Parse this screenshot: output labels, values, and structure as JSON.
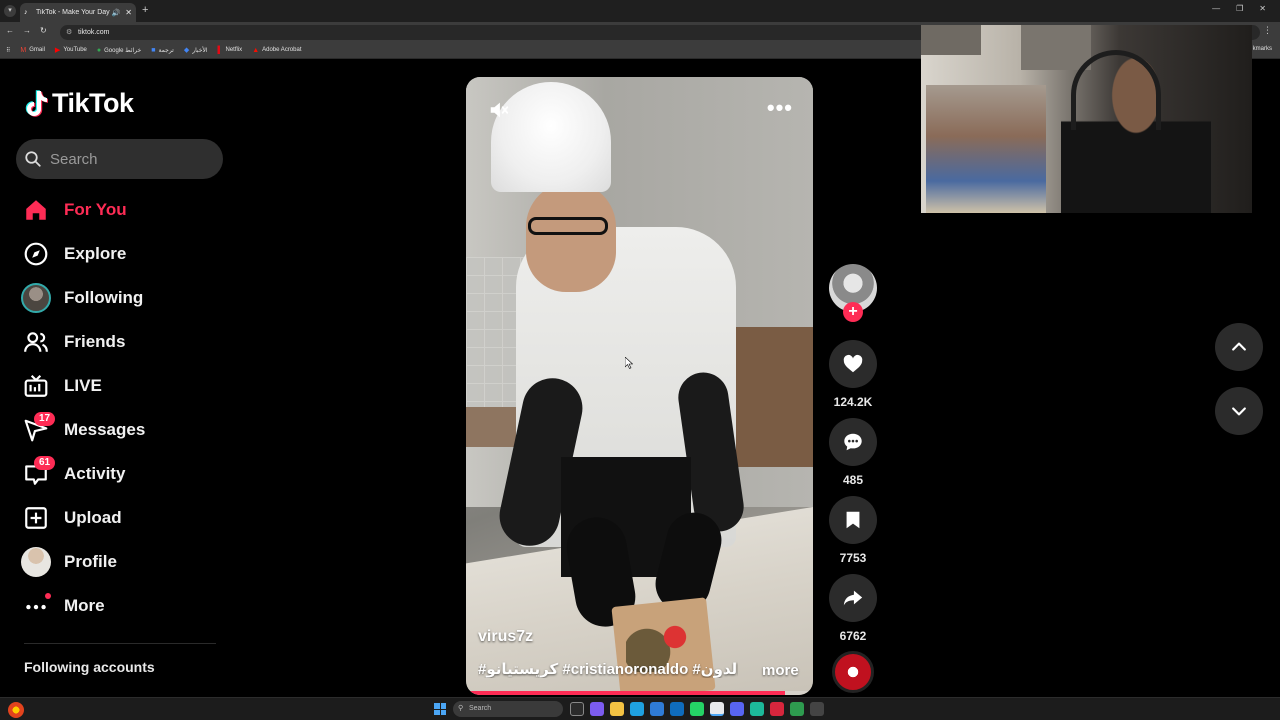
{
  "browser": {
    "tab_title": "TikTok - Make Your Day",
    "url": "tiktok.com",
    "bookmarks": [
      {
        "label": "Gmail",
        "icon": "gmail-icon",
        "color": "#ea4335"
      },
      {
        "label": "YouTube",
        "icon": "youtube-icon",
        "color": "#ff0000"
      },
      {
        "label": "Google خرائط",
        "icon": "maps-icon",
        "color": "#34a853"
      },
      {
        "label": "ترجمة",
        "icon": "translate-icon",
        "color": "#4285f4"
      },
      {
        "label": "الأخبار",
        "icon": "news-icon",
        "color": "#4285f4"
      },
      {
        "label": "Netflix",
        "icon": "netflix-icon",
        "color": "#e50914"
      },
      {
        "label": "Adobe Acrobat",
        "icon": "acrobat-icon",
        "color": "#f40f02"
      }
    ],
    "bookmarks_right": "kmarks"
  },
  "app": {
    "brand": "TikTok",
    "accent": "#fe2c55",
    "search_placeholder": "Search"
  },
  "sidebar": {
    "items": [
      {
        "label": "For You",
        "icon": "home-icon",
        "active": true
      },
      {
        "label": "Explore",
        "icon": "compass-icon"
      },
      {
        "label": "Following",
        "icon": "following-avatar"
      },
      {
        "label": "Friends",
        "icon": "friends-icon"
      },
      {
        "label": "LIVE",
        "icon": "live-tv-icon"
      },
      {
        "label": "Messages",
        "icon": "send-icon",
        "badge": "17"
      },
      {
        "label": "Activity",
        "icon": "inbox-icon",
        "badge": "61"
      },
      {
        "label": "Upload",
        "icon": "plus-square-icon"
      },
      {
        "label": "Profile",
        "icon": "profile-avatar"
      },
      {
        "label": "More",
        "icon": "more-dots-icon"
      }
    ],
    "following_accounts": "Following accounts"
  },
  "video": {
    "author": "virus7z",
    "hashtags": "#كريستيانو #cristianoronaldo #الدون ...",
    "more_label": "more",
    "progress": 0.92
  },
  "actions": {
    "likes": "124.2K",
    "comments": "485",
    "saves": "7753",
    "shares": "6762"
  },
  "taskbar": {
    "search_placeholder": "Search"
  }
}
